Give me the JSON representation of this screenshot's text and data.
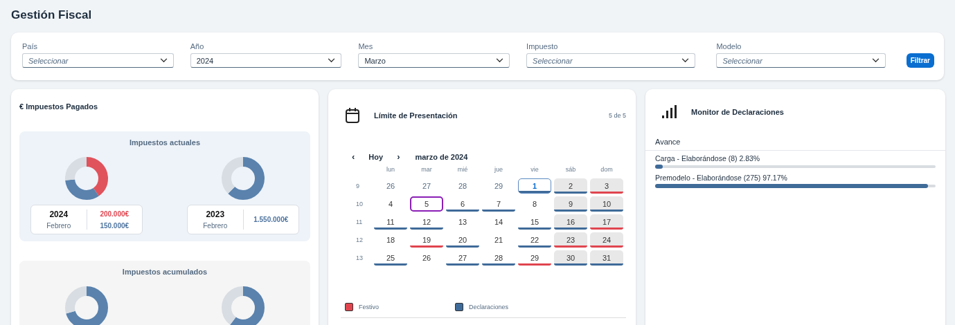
{
  "page_title": "Gestión Fiscal",
  "filters": [
    {
      "label": "País",
      "placeholder": "Seleccionar"
    },
    {
      "label": "Año",
      "value": "2024"
    },
    {
      "label": "Mes",
      "value": "Marzo"
    },
    {
      "label": "Impuesto",
      "placeholder": "Seleccionar"
    },
    {
      "label": "Modelo",
      "placeholder": "Seleccionar"
    }
  ],
  "filter_button": "Filtrar",
  "taxes_card": {
    "title": "€ Impuestos Pagados",
    "panels": [
      {
        "title": "Impuestos actuales",
        "kind": "current",
        "items": [
          {
            "kind": "donut_summary",
            "year": "2024",
            "month": "Febrero",
            "amounts": [
              {
                "text": "200.000€",
                "color": "#e0454f"
              },
              {
                "text": "150.000€",
                "color": "#4f75a0"
              }
            ]
          },
          {
            "kind": "donut_summary",
            "year": "2023",
            "month": "Febrero",
            "amounts": [
              {
                "text": "1.550.000€",
                "color": "#4f75a0"
              }
            ]
          }
        ]
      },
      {
        "title": "Impuestos acumulados",
        "kind": "accumulated",
        "items": [
          {
            "kind": "donut"
          },
          {
            "kind": "donut"
          }
        ]
      }
    ]
  },
  "calendar_card": {
    "title": "Límite de Presentación",
    "counter": "5 de 5",
    "prev": "‹",
    "today_button": "Hoy",
    "next": "›",
    "month_label": "marzo de 2024",
    "weekdays": [
      "lun",
      "mar",
      "mié",
      "jue",
      "vie",
      "sáb",
      "dom"
    ],
    "weeks": [
      {
        "number": "9",
        "days": [
          {
            "day": "26",
            "in_month": false,
            "kind": "plain",
            "today": false,
            "selected": false
          },
          {
            "day": "27",
            "in_month": false,
            "kind": "plain",
            "today": false,
            "selected": false
          },
          {
            "day": "28",
            "in_month": false,
            "kind": "plain",
            "today": false,
            "selected": false
          },
          {
            "day": "29",
            "in_month": false,
            "kind": "plain",
            "today": false,
            "selected": false
          },
          {
            "day": "1",
            "in_month": true,
            "kind": "filing",
            "today": true,
            "selected": false
          },
          {
            "day": "2",
            "in_month": true,
            "kind": "filing",
            "today": false,
            "selected": false
          },
          {
            "day": "3",
            "in_month": true,
            "kind": "holiday",
            "today": false,
            "selected": false
          }
        ]
      },
      {
        "number": "10",
        "days": [
          {
            "day": "4",
            "in_month": true,
            "kind": "plain",
            "today": false,
            "selected": false
          },
          {
            "day": "5",
            "in_month": true,
            "kind": "plain",
            "today": false,
            "selected": true
          },
          {
            "day": "6",
            "in_month": true,
            "kind": "filing",
            "today": false,
            "selected": false
          },
          {
            "day": "7",
            "in_month": true,
            "kind": "filing",
            "today": false,
            "selected": false
          },
          {
            "day": "8",
            "in_month": true,
            "kind": "plain",
            "today": false,
            "selected": false
          },
          {
            "day": "9",
            "in_month": true,
            "kind": "filing",
            "today": false,
            "selected": false
          },
          {
            "day": "10",
            "in_month": true,
            "kind": "filing",
            "today": false,
            "selected": false
          }
        ]
      },
      {
        "number": "11",
        "days": [
          {
            "day": "11",
            "in_month": true,
            "kind": "filing",
            "today": false,
            "selected": false
          },
          {
            "day": "12",
            "in_month": true,
            "kind": "filing",
            "today": false,
            "selected": false
          },
          {
            "day": "13",
            "in_month": true,
            "kind": "plain",
            "today": false,
            "selected": false
          },
          {
            "day": "14",
            "in_month": true,
            "kind": "plain",
            "today": false,
            "selected": false
          },
          {
            "day": "15",
            "in_month": true,
            "kind": "filing",
            "today": false,
            "selected": false
          },
          {
            "day": "16",
            "in_month": true,
            "kind": "filing",
            "today": false,
            "selected": false
          },
          {
            "day": "17",
            "in_month": true,
            "kind": "holiday",
            "today": false,
            "selected": false
          }
        ]
      },
      {
        "number": "12",
        "days": [
          {
            "day": "18",
            "in_month": true,
            "kind": "plain",
            "today": false,
            "selected": false
          },
          {
            "day": "19",
            "in_month": true,
            "kind": "holiday",
            "today": false,
            "selected": false
          },
          {
            "day": "20",
            "in_month": true,
            "kind": "filing",
            "today": false,
            "selected": false
          },
          {
            "day": "21",
            "in_month": true,
            "kind": "plain",
            "today": false,
            "selected": false
          },
          {
            "day": "22",
            "in_month": true,
            "kind": "filing",
            "today": false,
            "selected": false
          },
          {
            "day": "23",
            "in_month": true,
            "kind": "holiday",
            "today": false,
            "selected": false
          },
          {
            "day": "24",
            "in_month": true,
            "kind": "holiday",
            "today": false,
            "selected": false
          }
        ]
      },
      {
        "number": "13",
        "days": [
          {
            "day": "25",
            "in_month": true,
            "kind": "filing",
            "today": false,
            "selected": false
          },
          {
            "day": "26",
            "in_month": true,
            "kind": "plain",
            "today": false,
            "selected": false
          },
          {
            "day": "27",
            "in_month": true,
            "kind": "filing",
            "today": false,
            "selected": false
          },
          {
            "day": "28",
            "in_month": true,
            "kind": "filing",
            "today": false,
            "selected": false
          },
          {
            "day": "29",
            "in_month": true,
            "kind": "holiday",
            "today": false,
            "selected": false
          },
          {
            "day": "30",
            "in_month": true,
            "kind": "filing",
            "today": false,
            "selected": false
          },
          {
            "day": "31",
            "in_month": true,
            "kind": "filing",
            "today": false,
            "selected": false
          }
        ]
      }
    ],
    "legend": [
      {
        "label": "Festivo",
        "kind": "holiday",
        "color": "#e0454f"
      },
      {
        "label": "Declaraciones",
        "kind": "filing",
        "color": "#3f6b99"
      }
    ]
  },
  "monitor_card": {
    "title": "Monitor de Declaraciones",
    "section": "Avance",
    "items": [
      {
        "label": "Carga - Elaborándose (8) 2.83%",
        "level": 0.0283
      },
      {
        "label": "Premodelo - Elaborándose (275) 97.17%",
        "level": 0.9717
      }
    ]
  }
}
